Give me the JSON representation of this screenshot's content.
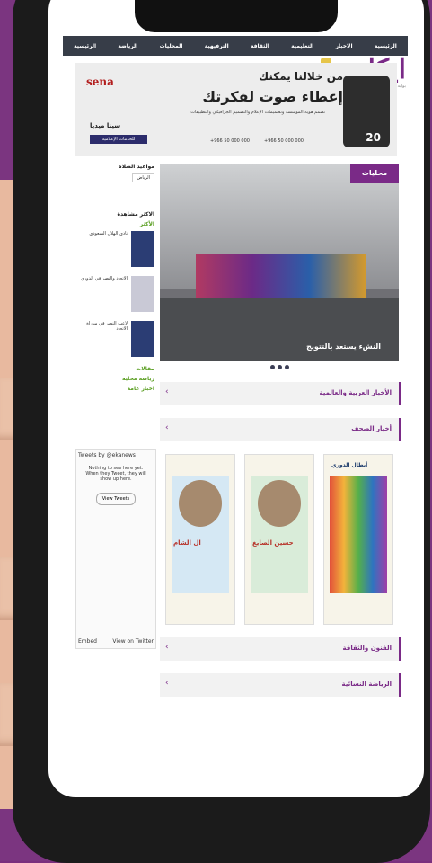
{
  "site": {
    "logo_text": "ايكا",
    "tagline": "بوابة المرأة والطفل"
  },
  "nav": {
    "items": [
      "الرئيسية",
      "الاخبار",
      "التعليمية",
      "الثقافة",
      "الترفيهية",
      "المحليات",
      "الرياضة",
      "الرئيسية"
    ]
  },
  "banner": {
    "line1": "من خلالنا يمكنك",
    "line2": "إعطاء صوت لفكرتك",
    "body": "نصمم هوية المؤسسة وتصميمات الإعلام والتصميم الجرافيكي والتطبيقات",
    "phone1": "+966 50 000 000",
    "phone2": "+966 50 000 000",
    "badge": "20",
    "brand": "sena",
    "brand_name": "سينا ميديا",
    "brand_sub": "للخدمات الإعلامية"
  },
  "sidebar": {
    "prayer_title": "مواعيد الصلاة",
    "prayer_tag": "الرياض",
    "most_viewed_title": "الاكثر مشاهدة",
    "views_tab": "الأكثر",
    "items": [
      {
        "text": "نادي الهلال السعودي"
      },
      {
        "text": "الاتحاد والنصر في الدوري"
      },
      {
        "text": "لاعب النصر في مباراة الاتحاد"
      }
    ],
    "links": [
      "مقالات",
      "رياضة محلية",
      "اخبار عامة"
    ]
  },
  "twitter": {
    "title": "Tweets by",
    "handle": "@ekanews",
    "message": "Nothing to see here yet. When they Tweet, they will show up here.",
    "button": "View Tweets",
    "footer_left": "Embed",
    "footer_right": "View on Twitter"
  },
  "slider": {
    "tag": "محليات",
    "caption": "النشء يستعد بالتتويج"
  },
  "sections": [
    {
      "title": "الأخبار العربية والعالمية"
    },
    {
      "title": "أخبار الصحف"
    },
    {
      "title": "الفنون والثقافة"
    },
    {
      "title": "الرياضة النسائية"
    }
  ],
  "papers": [
    {
      "headline": "أبطال الدوري"
    },
    {
      "headline": "حسين الصايغ"
    },
    {
      "headline": "ال الشام"
    }
  ]
}
